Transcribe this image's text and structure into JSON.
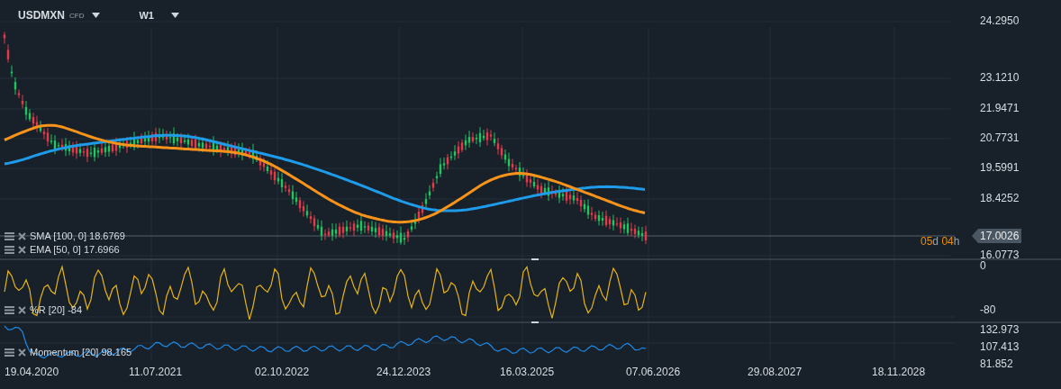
{
  "symbol": {
    "name": "USDMXN",
    "type": "CFD"
  },
  "timeframe": "W1",
  "price_axis": [
    "24.2950",
    "23.1210",
    "21.9471",
    "20.7731",
    "19.5991",
    "18.4252",
    "16.0773"
  ],
  "last_price": "17.0026",
  "countdown": [
    {
      "text": "05",
      "kind": "number"
    },
    {
      "text": "d ",
      "kind": "unit"
    },
    {
      "text": "04",
      "kind": "number"
    },
    {
      "text": "h",
      "kind": "unit"
    }
  ],
  "indicators": [
    {
      "label": "SMA [100, 0] 18.6769",
      "color": "#1e9be9"
    },
    {
      "label": "EMA [50, 0] 17.6966",
      "color": "#f7931a"
    }
  ],
  "wr_panel": {
    "label": "%R [20] -84",
    "axis": [
      "0",
      "-80"
    ]
  },
  "momentum_panel": {
    "label": "Momentum [20] 98.165",
    "axis": [
      "132.973",
      "107.413",
      "81.852"
    ]
  },
  "dates": [
    "19.04.2020",
    "11.07.2021",
    "02.10.2022",
    "24.12.2023",
    "16.03.2025",
    "07.06.2026",
    "29.08.2027",
    "18.11.2028"
  ]
}
